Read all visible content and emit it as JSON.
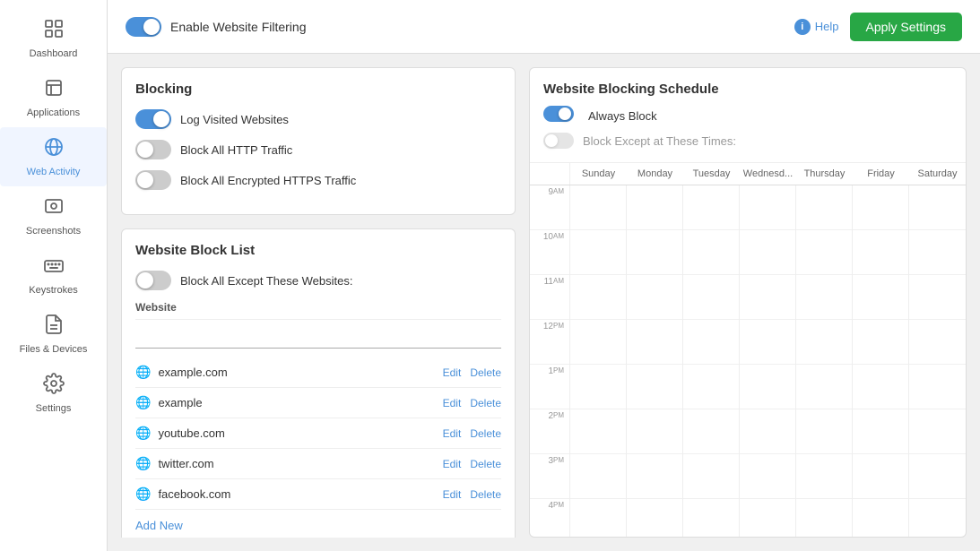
{
  "sidebar": {
    "items": [
      {
        "id": "dashboard",
        "label": "Dashboard",
        "icon": "⊞"
      },
      {
        "id": "applications",
        "label": "Applications",
        "icon": "⬜"
      },
      {
        "id": "web-activity",
        "label": "Web Activity",
        "icon": "🌐"
      },
      {
        "id": "screenshots",
        "label": "Screenshots",
        "icon": "🖼"
      },
      {
        "id": "keystrokes",
        "label": "Keystrokes",
        "icon": "⌨"
      },
      {
        "id": "files-devices",
        "label": "Files & Devices",
        "icon": "📄"
      },
      {
        "id": "settings",
        "label": "Settings",
        "icon": "⚙"
      }
    ]
  },
  "topbar": {
    "enable_label": "Enable Website Filtering",
    "help_label": "Help",
    "apply_label": "Apply Settings",
    "enable_toggle": true
  },
  "blocking": {
    "title": "Blocking",
    "log_visited": {
      "label": "Log Visited Websites",
      "on": true
    },
    "block_http": {
      "label": "Block All HTTP Traffic",
      "on": false
    },
    "block_https": {
      "label": "Block All Encrypted HTTPS Traffic",
      "on": false
    }
  },
  "website_block_list": {
    "title": "Website Block List",
    "block_all_except": {
      "label": "Block All Except These Websites:",
      "on": false
    },
    "column_header": "Website",
    "input_placeholder": "",
    "websites": [
      {
        "name": "example.com"
      },
      {
        "name": "example"
      },
      {
        "name": "youtube.com"
      },
      {
        "name": "twitter.com"
      },
      {
        "name": "facebook.com"
      }
    ],
    "edit_label": "Edit",
    "delete_label": "Delete",
    "add_new_label": "Add New"
  },
  "schedule": {
    "title": "Website Blocking Schedule",
    "always_block": {
      "label": "Always Block",
      "on": true
    },
    "block_except": {
      "label": "Block Except at These Times:",
      "on": false
    },
    "days": [
      "Sunday",
      "Monday",
      "Tuesday",
      "Wednesd...",
      "Thursday",
      "Friday",
      "Saturday"
    ],
    "times": [
      {
        "hour": "9",
        "suffix": "AM"
      },
      {
        "hour": "10",
        "suffix": "AM"
      },
      {
        "hour": "11",
        "suffix": "AM"
      },
      {
        "hour": "12",
        "suffix": "PM"
      },
      {
        "hour": "1",
        "suffix": "PM"
      },
      {
        "hour": "2",
        "suffix": "PM"
      },
      {
        "hour": "3",
        "suffix": "PM"
      },
      {
        "hour": "4",
        "suffix": "PM"
      }
    ]
  }
}
